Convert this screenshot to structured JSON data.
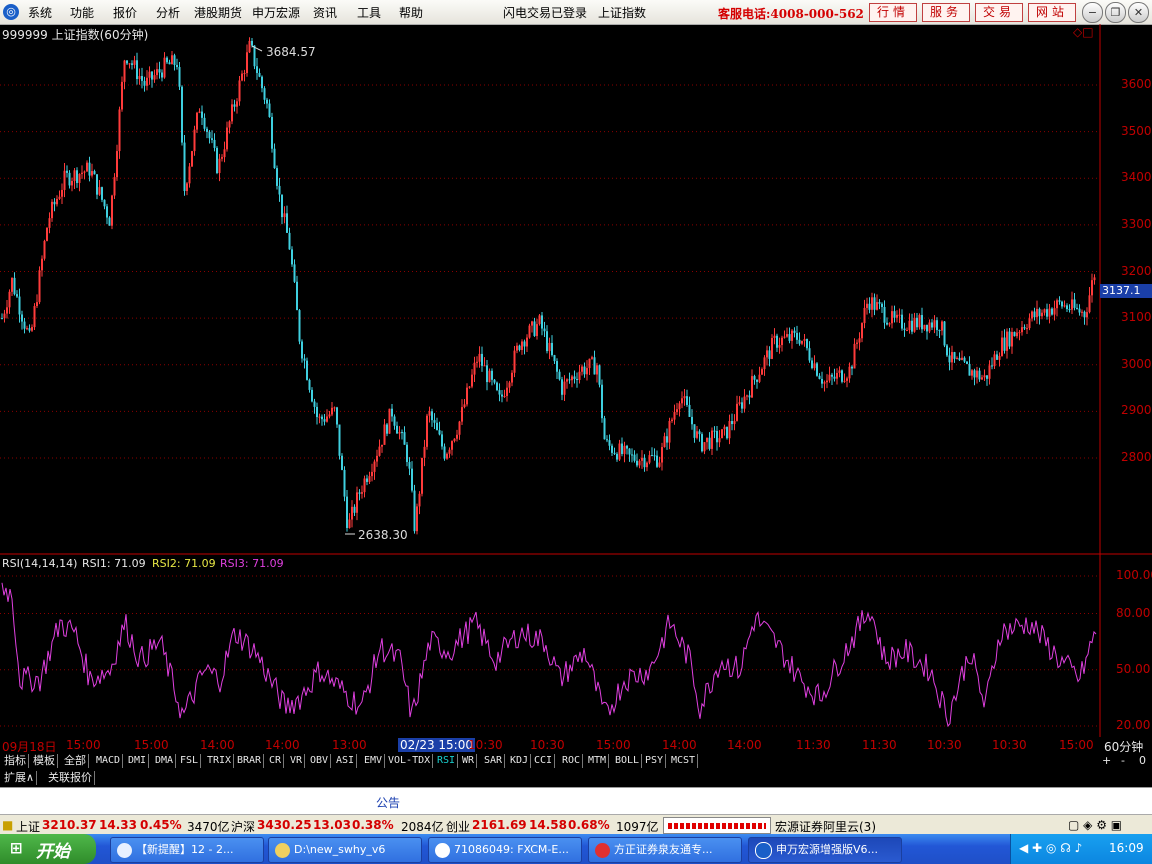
{
  "menubar": {
    "items": [
      "系统",
      "功能",
      "报价",
      "分析",
      "港股期货",
      "申万宏源",
      "资讯",
      "工具",
      "帮助"
    ],
    "login_status": "闪电交易已登录",
    "current_index": "上证指数",
    "hotline": "客服电话:4008-000-562",
    "buttons": [
      "行情",
      "服务",
      "交易",
      "网站"
    ]
  },
  "chart": {
    "title": "999999 上证指数(60分钟)",
    "high_label": "3684.57",
    "low_label": "2638.30",
    "current_price": "3137.1",
    "y_ticks": [
      "3600",
      "3500",
      "3400",
      "3300",
      "3200",
      "3100",
      "3000",
      "2900",
      "2800"
    ]
  },
  "rsi": {
    "params": "RSI(14,14,14)",
    "rsi1": "RSI1: 71.09",
    "rsi2": "RSI2: 71.09",
    "rsi3": "RSI3: 71.09",
    "y_ticks": [
      "100.00",
      "80.00",
      "50.00",
      "20.00"
    ]
  },
  "xaxis": {
    "labels": [
      "09月18日",
      "15:00",
      "15:00",
      "14:00",
      "14:00",
      "13:00",
      "02/23 15:00",
      "10:30",
      "10:30",
      "15:00",
      "14:00",
      "14:00",
      "11:30",
      "11:30",
      "10:30",
      "10:30",
      "15:00"
    ],
    "period": "60分钟"
  },
  "tabs": [
    "指标",
    "模板",
    "全部",
    "MACD",
    "DMI",
    "DMA",
    "FSL",
    "TRIX",
    "BRAR",
    "CR",
    "VR",
    "OBV",
    "ASI",
    "EMV",
    "VOL-TDX",
    "RSI",
    "WR",
    "SAR",
    "KDJ",
    "CCI",
    "ROC",
    "MTM",
    "BOLL",
    "PSY",
    "MCST"
  ],
  "ext_tabs": [
    "扩展∧",
    "关联报价"
  ],
  "zoom_controls": [
    "+",
    "-",
    "0"
  ],
  "announce": "公告",
  "status": {
    "sh_name": "上证",
    "sh_value": "3210.37",
    "sh_change": "14.33",
    "sh_pct": "0.45%",
    "sh_amount": "3470亿",
    "hs_name": "沪深",
    "hs_value": "3430.25",
    "hs_change": "13.03",
    "hs_pct": "0.38%",
    "hs_amount": "2084亿",
    "cy_name": "创业",
    "cy_value": "2161.69",
    "cy_change": "14.58",
    "cy_pct": "0.68%",
    "cy_amount": "1097亿",
    "server": "宏源证券阿里云(3)"
  },
  "taskbar": {
    "start": "开始",
    "tasks": [
      "【新提醒】12 - 2...",
      "D:\\new_swhy_v6",
      "71086049: FXCM-E...",
      "方正证券泉友通专...",
      "申万宏源增强版V6..."
    ],
    "clock": "16:09"
  },
  "colors": {
    "up": "#ff3b3b",
    "down": "#3fd0e0",
    "rsi": "#e040e0",
    "axis": "#c00000",
    "grid": "#8a0000"
  }
}
